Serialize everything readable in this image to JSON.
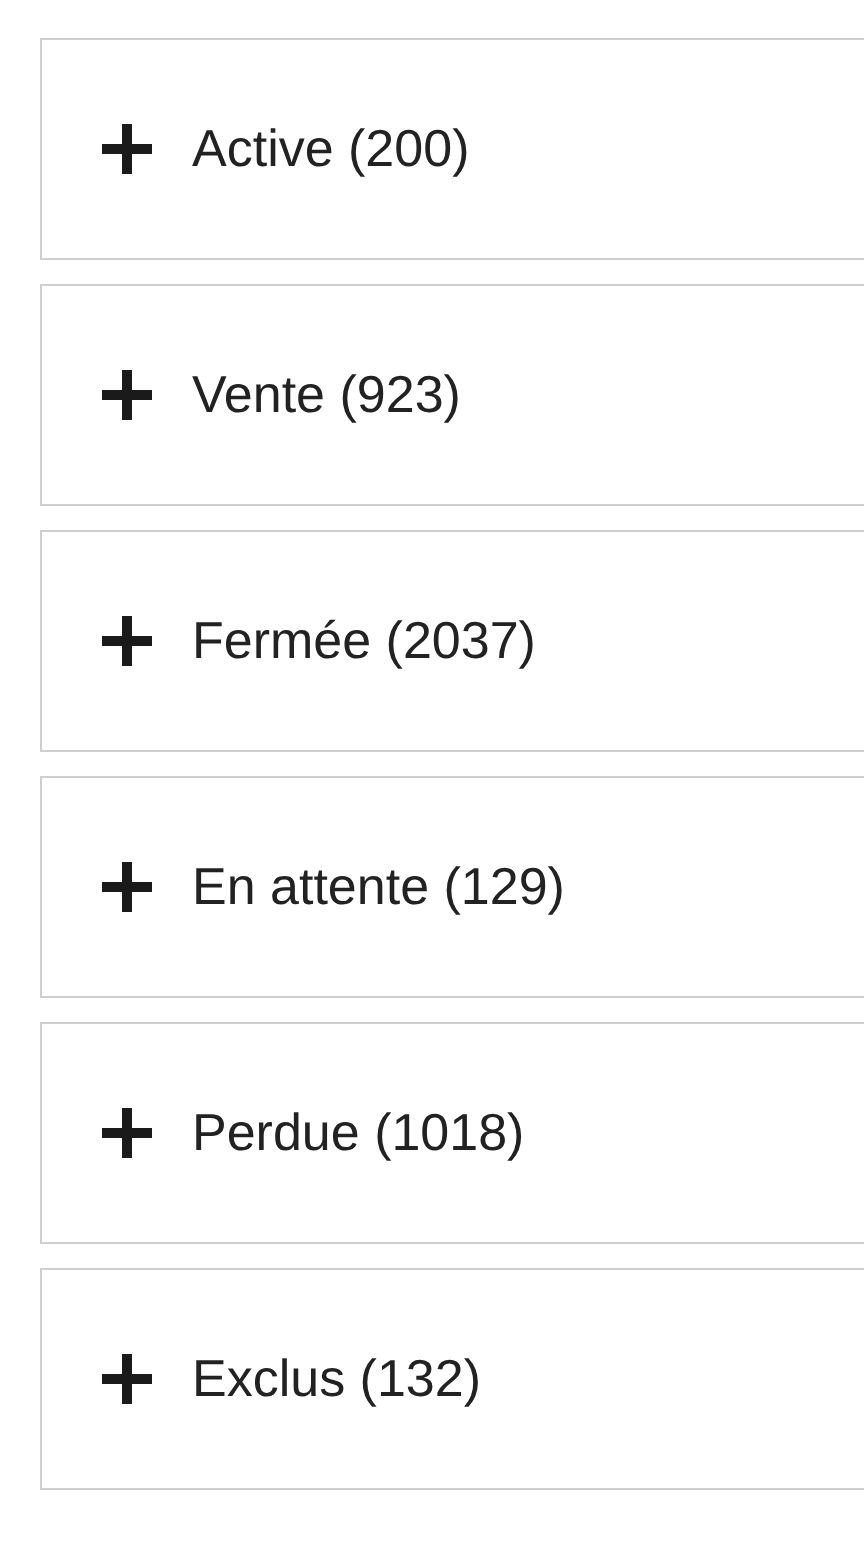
{
  "sections": [
    {
      "label": "Active (200)",
      "expanded": false
    },
    {
      "label": "Vente (923)",
      "expanded": false
    },
    {
      "label": "Fermée (2037)",
      "expanded": false
    },
    {
      "label": "En attente (129)",
      "expanded": false
    },
    {
      "label": "Perdue (1018)",
      "expanded": false
    },
    {
      "label": "Exclus (132)",
      "expanded": false
    }
  ]
}
